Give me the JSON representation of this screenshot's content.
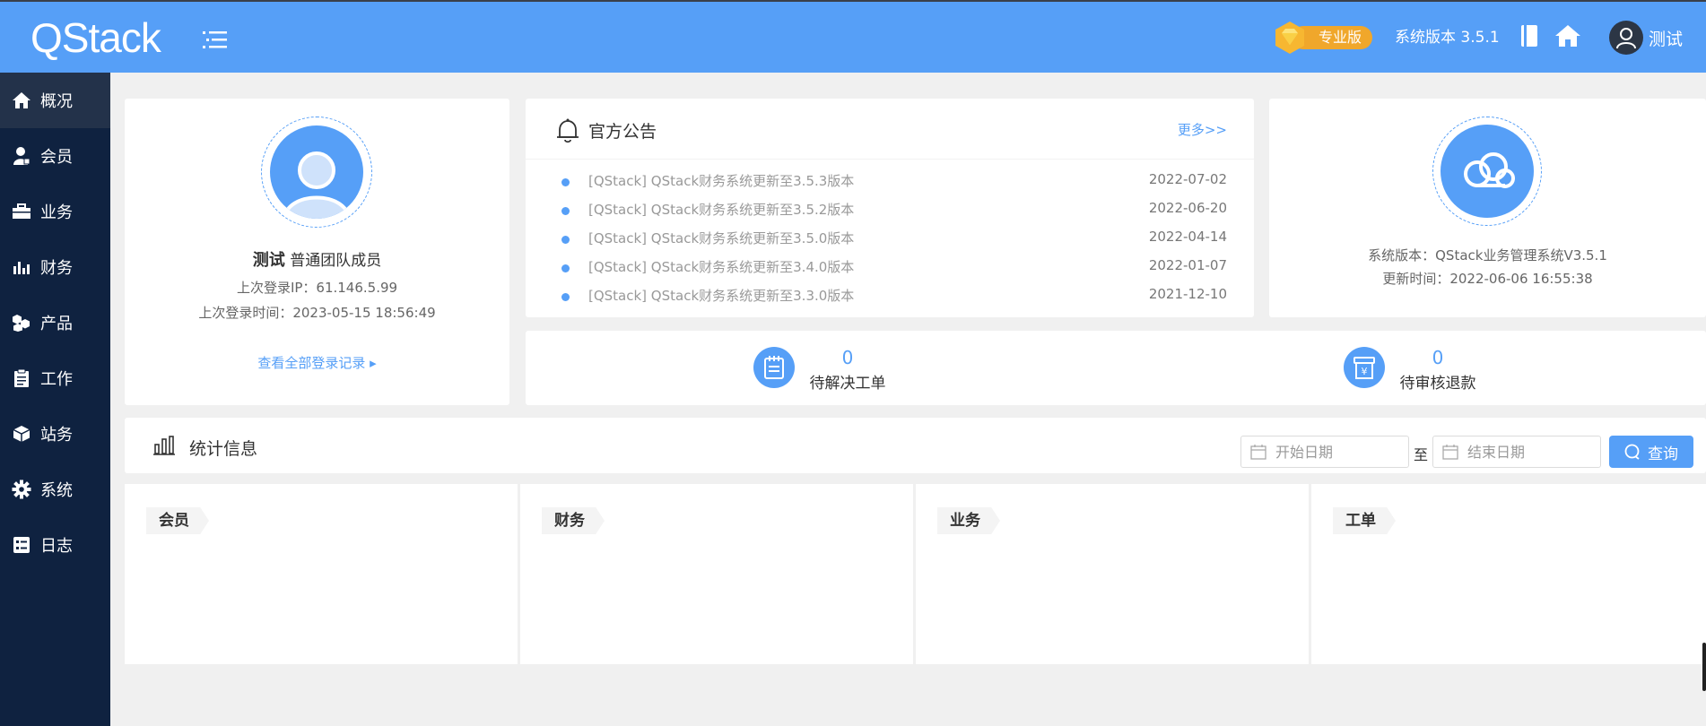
{
  "header": {
    "logo": "QStack",
    "edition_label": "专业版",
    "system_version": "系统版本 3.5.1",
    "user_name": "测试"
  },
  "sidebar": {
    "items": [
      {
        "label": "概况",
        "icon": "home-icon"
      },
      {
        "label": "会员",
        "icon": "user-icon"
      },
      {
        "label": "业务",
        "icon": "briefcase-icon"
      },
      {
        "label": "财务",
        "icon": "bar-chart-icon"
      },
      {
        "label": "产品",
        "icon": "cubes-icon"
      },
      {
        "label": "工作",
        "icon": "clipboard-icon"
      },
      {
        "label": "站务",
        "icon": "box-icon"
      },
      {
        "label": "系统",
        "icon": "gear-icon"
      },
      {
        "label": "日志",
        "icon": "checklist-icon"
      }
    ]
  },
  "profile": {
    "name": "测试",
    "role": "普通团队成员",
    "last_ip": "上次登录IP：61.146.5.99",
    "last_time": "上次登录时间：2023-05-15 18:56:49",
    "view_all": "查看全部登录记录 ▸"
  },
  "notice": {
    "title": "官方公告",
    "more": "更多>>",
    "items": [
      {
        "text": "[QStack] QStack财务系统更新至3.5.3版本",
        "date": "2022-07-02"
      },
      {
        "text": "[QStack] QStack财务系统更新至3.5.2版本",
        "date": "2022-06-20"
      },
      {
        "text": "[QStack] QStack财务系统更新至3.5.0版本",
        "date": "2022-04-14"
      },
      {
        "text": "[QStack] QStack财务系统更新至3.4.0版本",
        "date": "2022-01-07"
      },
      {
        "text": "[QStack] QStack财务系统更新至3.3.0版本",
        "date": "2021-12-10"
      }
    ]
  },
  "sysinfo": {
    "version": "系统版本：QStack业务管理系统V3.5.1",
    "updated": "更新时间：2022-06-06 16:55:38"
  },
  "pending": {
    "tickets": {
      "count": "0",
      "label": "待解决工单"
    },
    "refunds": {
      "count": "0",
      "label": "待审核退款"
    }
  },
  "stats": {
    "title": "统计信息",
    "start_placeholder": "开始日期",
    "to": "至",
    "end_placeholder": "结束日期",
    "query": "查询",
    "cards": [
      {
        "label": "会员"
      },
      {
        "label": "财务"
      },
      {
        "label": "业务"
      },
      {
        "label": "工单"
      }
    ]
  },
  "colors": {
    "primary": "#569ff7",
    "sidebar": "#0f2240",
    "badge": "#f0a72b"
  }
}
